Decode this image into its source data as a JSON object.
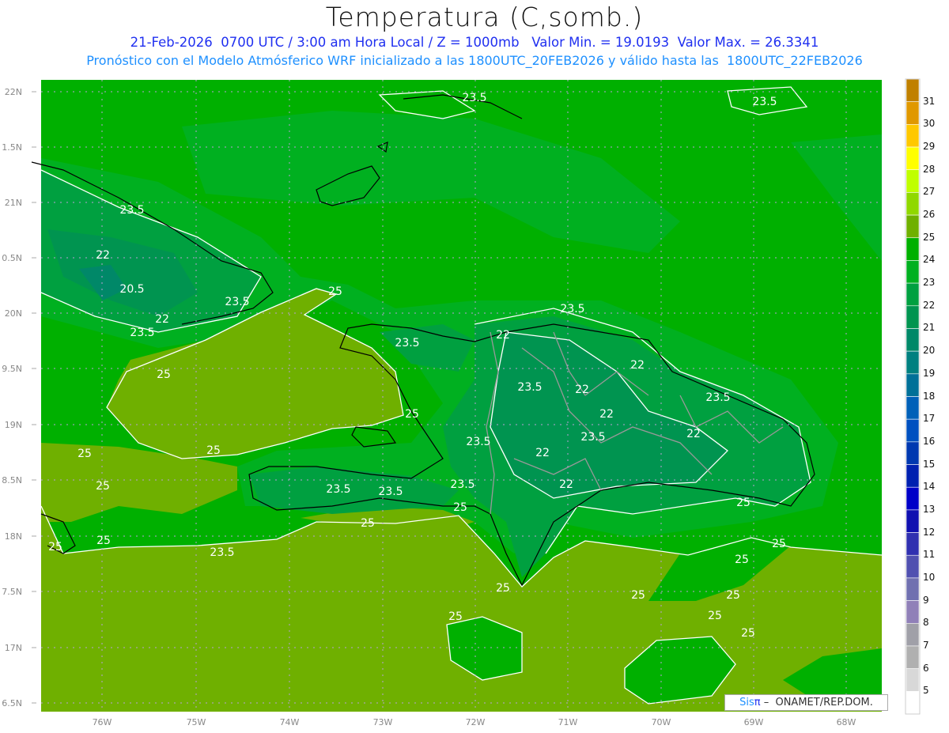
{
  "header": {
    "title": "Temperatura (C,somb.)",
    "line1": "21-Feb-2026  0700 UTC / 3:00 am Hora Local / Z = 1000mb   Valor Min. = 19.0193  Valor Max. = 26.3341",
    "line2": "Pronóstico con el Modelo Atmósferico WRF inicializado a las 1800UTC_20FEB2026 y válido hasta las  1800UTC_22FEB2026"
  },
  "axes": {
    "lon_labels": [
      "76W",
      "75W",
      "74W",
      "73W",
      "72W",
      "71W",
      "70W",
      "69W",
      "68W"
    ],
    "lat_labels": [
      "22N",
      "1.5N",
      "21N",
      "0.5N",
      "20N",
      "9.5N",
      "19N",
      "8.5N",
      "18N",
      "7.5N",
      "17N",
      "6.5N"
    ]
  },
  "colorbar": {
    "labels": [
      "31",
      "30",
      "29",
      "28",
      "27",
      "26",
      "25",
      "24",
      "23",
      "22",
      "21",
      "20",
      "19",
      "18",
      "17",
      "16",
      "15",
      "14",
      "13",
      "12",
      "11",
      "10",
      "9",
      "8",
      "7",
      "6",
      "5"
    ],
    "colors": [
      "#c08000",
      "#e09800",
      "#ffc800",
      "#ffff00",
      "#c0ff00",
      "#90d800",
      "#6fb000",
      "#00b000",
      "#00b020",
      "#00a040",
      "#009450",
      "#008868",
      "#008080",
      "#007098",
      "#0060b8",
      "#0050c0",
      "#0038b0",
      "#0020b0",
      "#0000c8",
      "#1010b0",
      "#3030b0",
      "#5050b0",
      "#7070b0",
      "#9080b8",
      "#a0a0a8",
      "#b0b0b0",
      "#d8d8d8",
      "#ffffff"
    ]
  },
  "contour_labels": [
    "23.5",
    "23.5",
    "23.5",
    "22",
    "20.5",
    "23.5",
    "22",
    "23.5",
    "25",
    "23.5",
    "23.5",
    "22",
    "25",
    "23.5",
    "22",
    "23.5",
    "22",
    "22",
    "23.5",
    "22",
    "23.5",
    "22",
    "25",
    "25",
    "25",
    "25",
    "23.5",
    "23.5",
    "23.5",
    "22",
    "25",
    "25",
    "25",
    "25",
    "23.5",
    "25",
    "25",
    "25",
    "25",
    "25",
    "25",
    "25",
    "25",
    "25"
  ],
  "watermark": {
    "brand_a": "Sis",
    "brand_b": "π",
    "text": " –  ONAMET/REP.DOM."
  }
}
